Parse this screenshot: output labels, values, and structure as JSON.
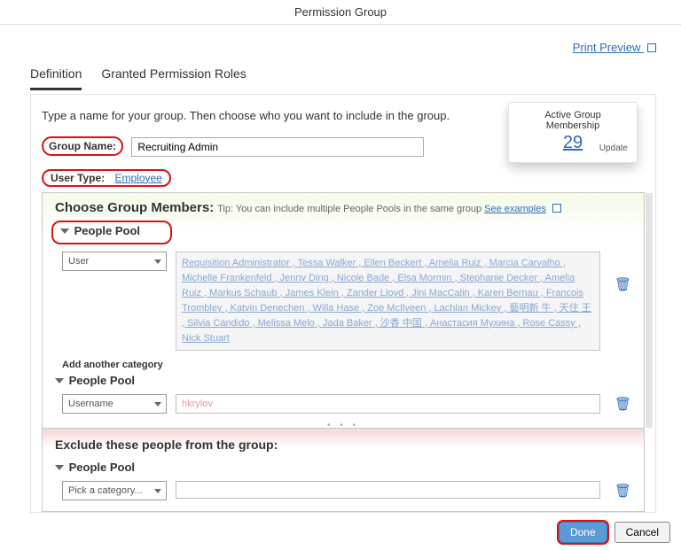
{
  "header": {
    "title": "Permission Group"
  },
  "top": {
    "print_preview": "Print Preview"
  },
  "tabs": {
    "definition": "Definition",
    "roles": "Granted Permission Roles"
  },
  "intro": "Type a name for your group. Then choose who you want to include in the group.",
  "membership": {
    "title": "Active Group Membership",
    "count": "29",
    "update": "Update"
  },
  "group_name": {
    "label": "Group Name:",
    "value": "Recruiting Admin"
  },
  "user_type": {
    "label": "User Type:",
    "value": "Employee"
  },
  "choose": {
    "title": "Choose Group Members:",
    "tip": "Tip: You can include multiple People Pools in the same group",
    "see": "See examples",
    "pool_title": "People Pool",
    "category_user": "User",
    "category_username": "Username",
    "add_category": "Add another category",
    "username_value": "hkrylov",
    "chips": "Requisition Administrator , Tessa Walker , Ellen Beckert , Amelia Ruiz , Marcia Carvalho , Michelle Frankenfeld , Jenny Ding , Nicole Bade , Elsa Mormin , Stephanie Decker , Amelia Ruiz , Markus Schaub , James Klein , Zander Lloyd , Jini MacCalin , Karen Bernau , Francois Trombley , Katvin Denechen , Willa Hase , Zoe McIlveen , Lachlan Mickey , 藝明新 牛 , 天住 王 , Silvia Candido , Melissa Melo , Jada Baker , 沙香 中国 , Анастасия Мухина , Rose Cassy , Nick Stuart"
  },
  "exclude": {
    "title": "Exclude these people from the group:",
    "pool_title": "People Pool",
    "category_placeholder": "Pick a category..."
  },
  "footer": {
    "done": "Done",
    "cancel": "Cancel"
  }
}
